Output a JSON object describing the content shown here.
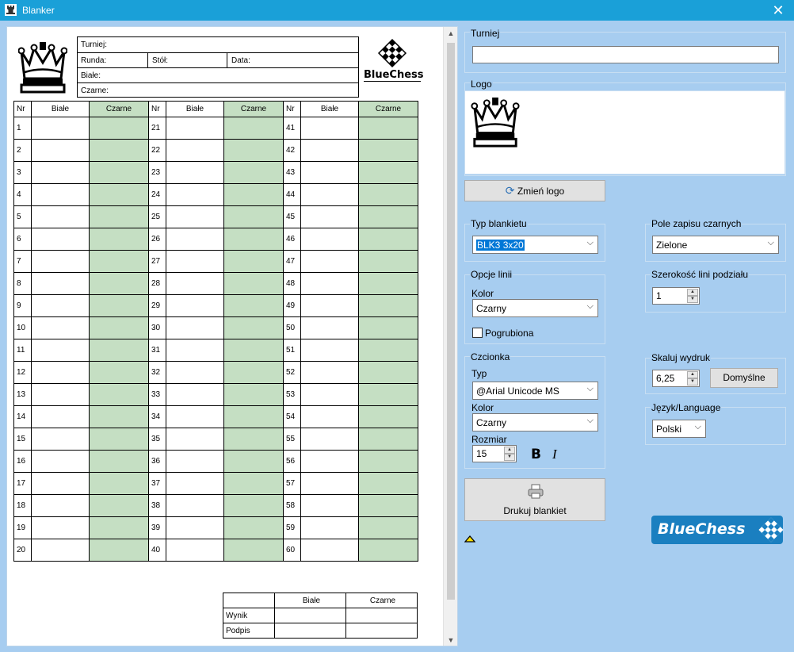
{
  "window": {
    "title": "Blanker",
    "close_glyph": "✕",
    "icon": "rook-icon"
  },
  "sheet": {
    "header": {
      "turniej": "Turniej:",
      "runda": "Runda:",
      "stol": "Stół:",
      "data": "Data:",
      "biale": "Białe:",
      "czarne": "Czarne:"
    },
    "brand": "BlueChess",
    "columns": {
      "nr": "Nr",
      "white": "Białe",
      "black": "Czarne"
    },
    "rows": [
      [
        1,
        21,
        41
      ],
      [
        2,
        22,
        42
      ],
      [
        3,
        23,
        43
      ],
      [
        4,
        24,
        44
      ],
      [
        5,
        25,
        45
      ],
      [
        6,
        26,
        46
      ],
      [
        7,
        27,
        47
      ],
      [
        8,
        28,
        48
      ],
      [
        9,
        29,
        49
      ],
      [
        10,
        30,
        50
      ],
      [
        11,
        31,
        51
      ],
      [
        12,
        32,
        52
      ],
      [
        13,
        33,
        53
      ],
      [
        14,
        34,
        54
      ],
      [
        15,
        35,
        55
      ],
      [
        16,
        36,
        56
      ],
      [
        17,
        37,
        57
      ],
      [
        18,
        38,
        58
      ],
      [
        19,
        39,
        59
      ],
      [
        20,
        40,
        60
      ]
    ],
    "result": {
      "header_white": "Białe",
      "header_black": "Czarne",
      "wynik": "Wynik",
      "podpis": "Podpis"
    },
    "black_column_color": "#c5dfc3"
  },
  "form": {
    "turniej": {
      "label": "Turniej",
      "value": ""
    },
    "logo": {
      "label": "Logo"
    },
    "change_logo": "Zmień logo",
    "typ_blankietu": {
      "label": "Typ blankietu",
      "value": "BLK3 3x20"
    },
    "pole_zapisu": {
      "label": "Pole zapisu czarnych",
      "value": "Zielone"
    },
    "opcje_linii": {
      "label": "Opcje linii",
      "kolor_label": "Kolor",
      "kolor_value": "Czarny",
      "pogrubiona": "Pogrubiona",
      "pogrubiona_checked": false
    },
    "szerokosc": {
      "label": "Szerokość lini podziału",
      "value": "1"
    },
    "czcionka": {
      "label": "Czcionka",
      "typ_label": "Typ",
      "typ_value": "@Arial Unicode MS",
      "kolor_label": "Kolor",
      "kolor_value": "Czarny",
      "rozmiar_label": "Rozmiar",
      "rozmiar_value": "15",
      "bold": "B",
      "italic": "I"
    },
    "skaluj": {
      "label": "Skaluj wydruk",
      "value": "6,25",
      "default_btn": "Domyślne"
    },
    "jezyk": {
      "label": "Język/Language",
      "value": "Polski"
    },
    "drukuj": "Drukuj blankiet",
    "brand": "BlueChess"
  },
  "colors": {
    "titlebar": "#1aa0d8",
    "form_bg": "#a7cdf0",
    "brand_blue": "#1a7fc0"
  }
}
